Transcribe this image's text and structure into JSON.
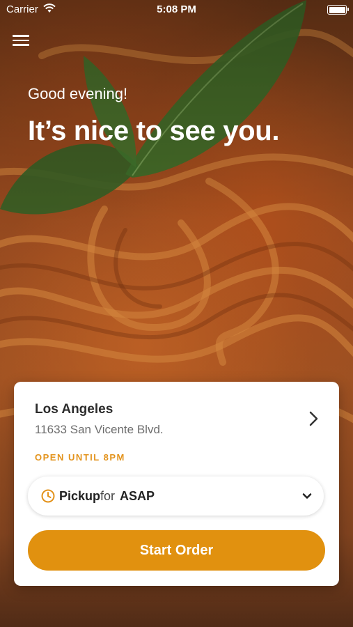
{
  "status_bar": {
    "carrier": "Carrier",
    "time": "5:08 PM"
  },
  "header": {
    "greeting": "Good evening!",
    "headline": "It’s nice to see you."
  },
  "location": {
    "name": "Los Angeles",
    "address": "11633 San Vicente Blvd.",
    "hours": "OPEN UNTIL 8PM"
  },
  "order_mode": {
    "mode": "Pickup",
    "connector": "for",
    "time": "ASAP"
  },
  "actions": {
    "start_order": "Start Order"
  },
  "colors": {
    "accent": "#e1910f",
    "hours_text": "#e3931c"
  },
  "icons": [
    "menu-icon",
    "wifi-icon",
    "battery-icon",
    "chevron-right-icon",
    "clock-icon",
    "chevron-down-icon"
  ]
}
